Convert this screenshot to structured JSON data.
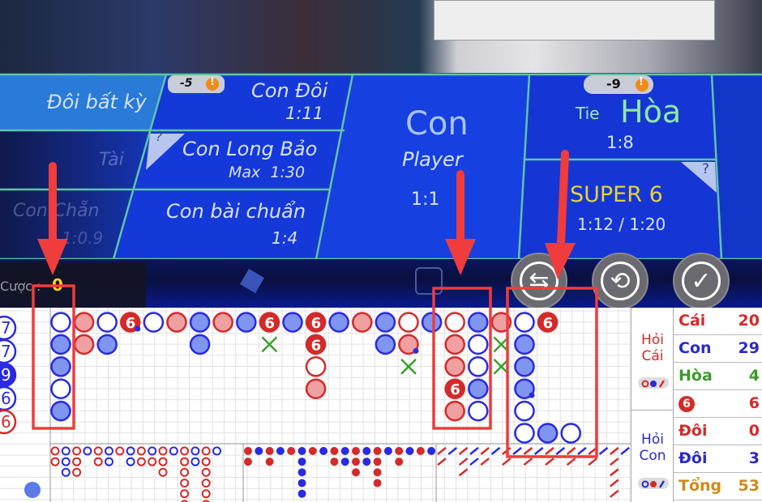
{
  "table": {
    "doi_bat_ky": "Đôi bất kỳ",
    "tai": "Tài",
    "con_chan": "Con Chẵn",
    "con_chan_odds": "1:0.9",
    "con_doi": "Con Đôi",
    "con_doi_odds": "1:11",
    "con_doi_badge": "-5",
    "con_long_bao": "Con Long Bảo",
    "con_long_bao_odds": "Max  1:30",
    "con_bai_chuan": "Con bài chuẩn",
    "con_bai_chuan_odds": "1:4",
    "con": "Con",
    "player": "Player",
    "player_odds": "1:1",
    "tie_en": "Tie",
    "tie_vi": "Hòa",
    "tie_odds": "1:8",
    "tie_badge": "-9",
    "super6": "SUPER 6",
    "super6_odds": "1:12 / 1:20",
    "help": "?",
    "warn": "!"
  },
  "controls": {
    "bet_label": "Cược :",
    "bet_value": "0",
    "undo_icon": "undo-icon",
    "repeat_icon": "repeat-icon",
    "confirm_icon": "check-icon"
  },
  "bead_left": [
    {
      "t": "p",
      "n": "7"
    },
    {
      "t": "p",
      "n": "7"
    },
    {
      "t": "pf",
      "n": "9"
    },
    {
      "t": "p",
      "n": "6"
    },
    {
      "t": "b",
      "n": "6"
    }
  ],
  "big_road": [
    {
      "c": 0,
      "r": 0,
      "t": "p"
    },
    {
      "c": 0,
      "r": 1,
      "t": "pf"
    },
    {
      "c": 0,
      "r": 2,
      "t": "pf"
    },
    {
      "c": 0,
      "r": 3,
      "t": "p"
    },
    {
      "c": 0,
      "r": 4,
      "t": "pf"
    },
    {
      "c": 1,
      "r": 0,
      "t": "bf"
    },
    {
      "c": 1,
      "r": 1,
      "t": "bf"
    },
    {
      "c": 2,
      "r": 0,
      "t": "p"
    },
    {
      "c": 2,
      "r": 1,
      "t": "pf"
    },
    {
      "c": 3,
      "r": 0,
      "t": "b6",
      "dot": true
    },
    {
      "c": 4,
      "r": 0,
      "t": "p"
    },
    {
      "c": 5,
      "r": 0,
      "t": "bf"
    },
    {
      "c": 6,
      "r": 0,
      "t": "pf"
    },
    {
      "c": 6,
      "r": 1,
      "t": "pf"
    },
    {
      "c": 7,
      "r": 0,
      "t": "bf"
    },
    {
      "c": 8,
      "r": 0,
      "t": "pf"
    },
    {
      "c": 9,
      "r": 0,
      "t": "b6"
    },
    {
      "c": 9,
      "r": 1,
      "t": "x"
    },
    {
      "c": 10,
      "r": 0,
      "t": "pf"
    },
    {
      "c": 11,
      "r": 0,
      "t": "b6"
    },
    {
      "c": 11,
      "r": 1,
      "t": "b6"
    },
    {
      "c": 11,
      "r": 2,
      "t": "b"
    },
    {
      "c": 11,
      "r": 3,
      "t": "bf"
    },
    {
      "c": 12,
      "r": 0,
      "t": "pf"
    },
    {
      "c": 13,
      "r": 0,
      "t": "bf"
    },
    {
      "c": 14,
      "r": 0,
      "t": "pf"
    },
    {
      "c": 14,
      "r": 1,
      "t": "pf"
    },
    {
      "c": 15,
      "r": 0,
      "t": "b"
    },
    {
      "c": 15,
      "r": 1,
      "t": "bf",
      "dot": true
    },
    {
      "c": 15,
      "r": 2,
      "t": "x"
    },
    {
      "c": 16,
      "r": 0,
      "t": "pf"
    },
    {
      "c": 17,
      "r": 0,
      "t": "b"
    },
    {
      "c": 17,
      "r": 1,
      "t": "bf"
    },
    {
      "c": 17,
      "r": 2,
      "t": "bf"
    },
    {
      "c": 17,
      "r": 3,
      "t": "b6"
    },
    {
      "c": 17,
      "r": 4,
      "t": "bf"
    },
    {
      "c": 18,
      "r": 0,
      "t": "pf"
    },
    {
      "c": 18,
      "r": 1,
      "t": "p"
    },
    {
      "c": 18,
      "r": 2,
      "t": "p"
    },
    {
      "c": 18,
      "r": 3,
      "t": "pf"
    },
    {
      "c": 18,
      "r": 4,
      "t": "p"
    },
    {
      "c": 19,
      "r": 0,
      "t": "bf"
    },
    {
      "c": 19,
      "r": 1,
      "t": "x"
    },
    {
      "c": 19,
      "r": 2,
      "t": "x"
    },
    {
      "c": 20,
      "r": 0,
      "t": "p"
    },
    {
      "c": 20,
      "r": 1,
      "t": "pf"
    },
    {
      "c": 20,
      "r": 2,
      "t": "pf"
    },
    {
      "c": 20,
      "r": 3,
      "t": "pf",
      "dot": true
    },
    {
      "c": 20,
      "r": 4,
      "t": "p"
    },
    {
      "c": 20,
      "r": 5,
      "t": "p"
    },
    {
      "c": 21,
      "r": 0,
      "t": "b6"
    },
    {
      "c": 21,
      "r": 5,
      "t": "pf"
    },
    {
      "c": 22,
      "r": 5,
      "t": "p"
    }
  ],
  "big_eye_road": [
    "rr",
    "bbb",
    "rrr",
    "b",
    "rr",
    "bb",
    "r",
    "bb",
    "rr",
    "br",
    "rrr",
    "b",
    "rrrrrr",
    "bb",
    "rrrrrr",
    "b"
  ],
  "small_road": [
    "rr",
    "b",
    "rr",
    "b",
    "r",
    "bbbbb",
    "r",
    "b",
    "rr",
    "bb",
    "rrr",
    "bb",
    "rrrr",
    "b",
    "rr",
    "b",
    "r",
    "b"
  ],
  "cockroach_road": [
    "rr",
    "b",
    "rrr",
    "bb",
    "rr",
    "b",
    "rr",
    "b",
    "rr",
    "b",
    "rr",
    "b",
    "rr",
    "b",
    "rr",
    "b",
    "rrrrr",
    "b",
    "rr",
    "b"
  ],
  "ask": {
    "banker": "Hỏi Cái",
    "player": "Hỏi Con"
  },
  "stats": [
    {
      "label": "Cái",
      "value": "20",
      "color": "#d42a2a"
    },
    {
      "label": "Con",
      "value": "29",
      "color": "#2a2acc"
    },
    {
      "label": "Hòa",
      "value": "4",
      "color": "#3a9a2a"
    },
    {
      "label": "6",
      "value": "6",
      "color": "#d42a2a",
      "icon": true
    },
    {
      "label": "Đôi",
      "value": "0",
      "color": "#d42a2a"
    },
    {
      "label": "Đôi",
      "value": "3",
      "color": "#2a2acc"
    },
    {
      "label": "Tổng",
      "value": "53",
      "color": "#d08a1a"
    }
  ],
  "colors": {
    "banker": "#d42a2a",
    "player": "#2a2ae0",
    "tie": "#3aa02a",
    "table": "#1236c8",
    "annotation": "#f03c3c"
  }
}
